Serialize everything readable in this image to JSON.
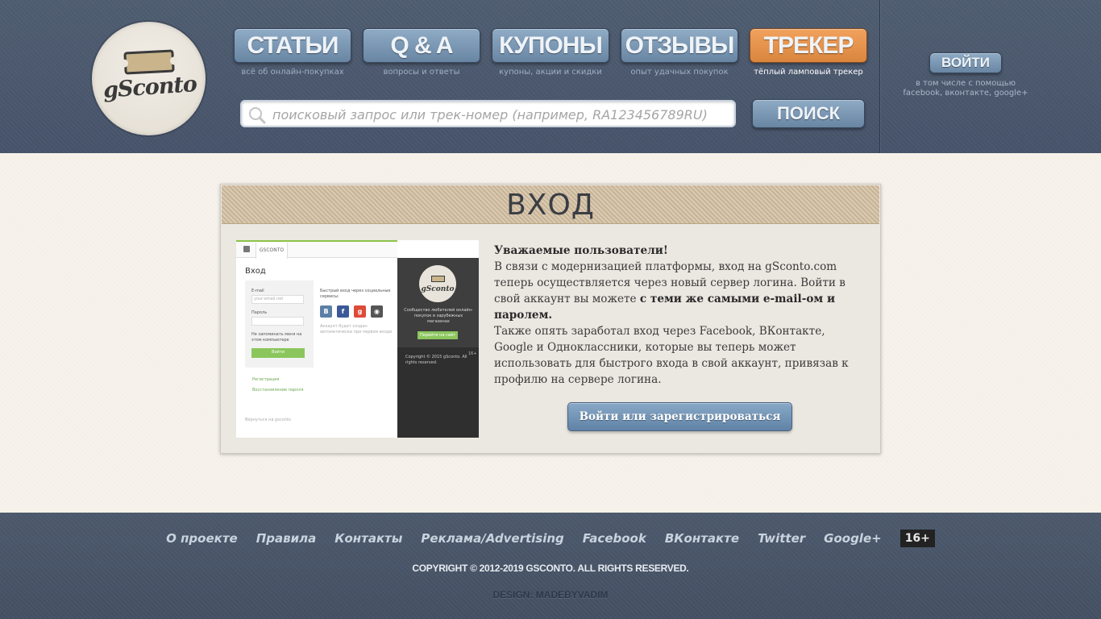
{
  "logo": {
    "text": "gSconto"
  },
  "nav": [
    {
      "label": "СТАТЬИ",
      "sub": "всё об онлайн-покупках",
      "active": false
    },
    {
      "label": "Q & A",
      "sub": "вопросы и ответы",
      "active": false
    },
    {
      "label": "КУПОНЫ",
      "sub": "купоны, акции и скидки",
      "active": false
    },
    {
      "label": "ОТЗЫВЫ",
      "sub": "опыт удачных покупок",
      "active": false
    },
    {
      "label": "ТРЕКЕР",
      "sub": "тёплый ламповый трекер",
      "active": true
    }
  ],
  "search": {
    "placeholder": "поисковый запрос или трек-номер (например, RA123456789RU)",
    "button": "ПОИСК"
  },
  "auth": {
    "login_button": "ВОЙТИ",
    "note_line1": "в том числе с помощью",
    "note_line2": "facebook, вконтакте, google+"
  },
  "card": {
    "title": "ВХОД",
    "greeting": "Уважаемые пользователи!",
    "p1_start": "В связи с модернизацией платформы, вход на gSconto.com теперь осуществляется через новый сервер логина. Войти в свой аккаунт вы можете ",
    "p1_bold": "с теми же самыми e-mail-ом и паролем.",
    "p2": "Также опять заработал вход через Facebook, ВКонтакте, Google и Одноклассники, которые вы теперь может использовать для быстрого входа в свой аккаунт, привязав к профилю на сервере логина.",
    "cta": "Войти или зарегистрироваться"
  },
  "preview": {
    "tab": "GSCONTO",
    "heading": "Вход",
    "email_label": "E-mail",
    "email_placeholder": "your-email.net",
    "password_label": "Пароль",
    "remember": "Не запоминать меня на этом компьютере",
    "login_btn": "Войти",
    "social_title": "Быстрый вход через социальные сервисы:",
    "social_note": "Аккаунт будет создан автоматически при первом входе",
    "register_link": "Регистрация",
    "restore_link": "Восстановление пароля",
    "back_link": "Вернуться на gsconto",
    "logo_text": "gSconto",
    "dark_text": "Сообщество любителей онлайн-покупок в зарубежных магазинах",
    "dark_btn": "Перейти на сайт",
    "copyright": "Copyright © 2015 gSconto. All rights reserved.",
    "age": "16+"
  },
  "footer": {
    "links": [
      "О проекте",
      "Правила",
      "Контакты",
      "Реклама/Advertising",
      "Facebook",
      "ВКонтакте",
      "Twitter",
      "Google+"
    ],
    "age": "16+",
    "copyright": "COPYRIGHT © 2012-2019 GSCONTO. ALL RIGHTS RESERVED.",
    "design": "DESIGN: MADEBYVADIM"
  }
}
